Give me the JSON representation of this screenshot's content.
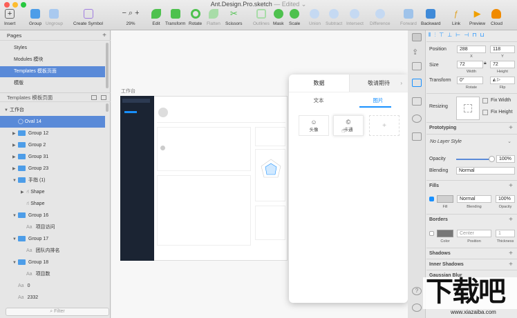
{
  "window": {
    "title": "Ant.Design.Pro.sketch",
    "subtitle": "— Edited ⌄"
  },
  "toolbar": {
    "insert": "Insert",
    "group": "Group",
    "ungroup": "Ungroup",
    "create_symbol": "Create Symbol",
    "zoom": "29%",
    "edit": "Edit",
    "transform": "Transform",
    "rotate": "Rotate",
    "flatten": "Flatten",
    "scissors": "Scissors",
    "outlines": "Outlines",
    "mask": "Mask",
    "scale": "Scale",
    "union": "Union",
    "subtract": "Subtract",
    "intersect": "Intersect",
    "difference": "Difference",
    "forward": "Forward",
    "backward": "Backward",
    "link": "Link",
    "preview": "Preview",
    "cloud": "Cloud"
  },
  "pages": {
    "header": "Pages",
    "items": [
      "Styles",
      "Modules 模块",
      "Templates 模板页面",
      "模版"
    ],
    "selected": 2
  },
  "layers": {
    "header": "Templates 模板页面",
    "rows": [
      {
        "label": "工作台",
        "type": "artboard",
        "indent": 0
      },
      {
        "label": "Oval 14",
        "type": "oval",
        "indent": 1,
        "selected": true
      },
      {
        "label": "Group 12",
        "type": "folder",
        "indent": 1
      },
      {
        "label": "Group 2",
        "type": "folder",
        "indent": 1
      },
      {
        "label": "Group 31",
        "type": "folder",
        "indent": 1
      },
      {
        "label": "Group 23",
        "type": "folder",
        "indent": 1
      },
      {
        "label": "手指 (1)",
        "type": "folder",
        "indent": 1,
        "open": true
      },
      {
        "label": "Shape",
        "type": "shape",
        "indent": 2
      },
      {
        "label": "Shape",
        "type": "shape",
        "indent": 2
      },
      {
        "label": "Group 16",
        "type": "folder",
        "indent": 1,
        "open": true
      },
      {
        "label": "项目访问",
        "type": "text",
        "indent": 2
      },
      {
        "label": "Group 17",
        "type": "folder",
        "indent": 1,
        "open": true
      },
      {
        "label": "团队内排名",
        "type": "text",
        "indent": 2
      },
      {
        "label": "Group 18",
        "type": "folder",
        "indent": 1,
        "open": true
      },
      {
        "label": "项目数",
        "type": "text",
        "indent": 2
      },
      {
        "label": "0",
        "type": "text",
        "indent": 1
      },
      {
        "label": "2332",
        "type": "text",
        "indent": 1
      }
    ],
    "filter_placeholder": "Filter"
  },
  "canvas": {
    "artboard_label": "工作台"
  },
  "overlay": {
    "tabs": [
      "数据",
      "敬请期待"
    ],
    "subtabs": [
      "文本",
      "图片"
    ],
    "cards": [
      "头像",
      "卡通"
    ]
  },
  "inspector": {
    "position_label": "Position",
    "x": "288",
    "y": "118",
    "x_label": "X",
    "y_label": "Y",
    "size_label": "Size",
    "width": "72",
    "height": "72",
    "width_label": "Width",
    "height_label": "Height",
    "transform_label": "Transform",
    "rotate": "0°",
    "rotate_label": "Rotate",
    "flip_label": "Flip",
    "resizing_label": "Resizing",
    "fix_width": "Fix Width",
    "fix_height": "Fix Height",
    "prototyping": "Prototyping",
    "layer_style": "No Layer Style",
    "opacity_label": "Opacity",
    "opacity": "100%",
    "blending_label": "Blending",
    "blending": "Normal",
    "fills": "Fills",
    "fill_blend": "Normal",
    "fill_opacity": "100%",
    "fill_label": "Fill",
    "fill_blend_label": "Blending",
    "fill_opacity_label": "Opacity",
    "borders": "Borders",
    "border_position": "Center",
    "border_thickness": "1",
    "color_label": "Color",
    "position_sub": "Position",
    "thickness_label": "Thickness",
    "shadows": "Shadows",
    "inner_shadows": "Inner Shadows",
    "gaussian_blur": "Gaussian Blur"
  },
  "watermark": {
    "text": "下载吧",
    "url": "www.xiazaiba.com"
  },
  "colors": {
    "selection": "#5a8ad8",
    "folder": "#4d9de8",
    "accent": "#1890ff"
  }
}
